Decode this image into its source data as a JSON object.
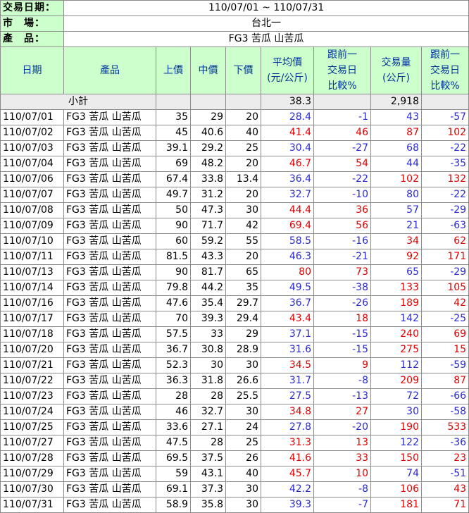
{
  "info": {
    "date_label": "交易日期：",
    "date_value": "110/07/01 ~ 110/07/31",
    "market_label": "市　場：",
    "market_value": "台北一",
    "product_label": "產　品：",
    "product_value": "FG3 苦瓜 山苦瓜"
  },
  "header": {
    "date": "日期",
    "product": "產品",
    "high": "上價",
    "mid": "中價",
    "low": "下價",
    "avg": [
      "平均價",
      "(元/公斤)"
    ],
    "avg_cmp": [
      "跟前一",
      "交易日",
      "比較%"
    ],
    "vol": [
      "交易量",
      "(公斤)"
    ],
    "vol_cmp": [
      "跟前一",
      "交易日",
      "比較%"
    ]
  },
  "subtotal": {
    "label": "小計",
    "avg": "38.3",
    "vol": "2,918"
  },
  "colors": {
    "up": "#e00000",
    "down": "#2929d6",
    "header_bg": "#ccffcc",
    "header_text": "#003399"
  },
  "rows": [
    {
      "date": "110/07/01",
      "product": "FG3 苦瓜 山苦瓜",
      "high": "35",
      "mid": "29",
      "low": "20",
      "avg": "28.4",
      "avg_cmp": "-1",
      "vol": "43",
      "vol_cmp": "-57"
    },
    {
      "date": "110/07/02",
      "product": "FG3 苦瓜 山苦瓜",
      "high": "45",
      "mid": "40.6",
      "low": "40",
      "avg": "41.4",
      "avg_cmp": "46",
      "vol": "87",
      "vol_cmp": "102"
    },
    {
      "date": "110/07/03",
      "product": "FG3 苦瓜 山苦瓜",
      "high": "39.1",
      "mid": "29.2",
      "low": "25",
      "avg": "30.4",
      "avg_cmp": "-27",
      "vol": "68",
      "vol_cmp": "-22"
    },
    {
      "date": "110/07/04",
      "product": "FG3 苦瓜 山苦瓜",
      "high": "69",
      "mid": "48.2",
      "low": "20",
      "avg": "46.7",
      "avg_cmp": "54",
      "vol": "44",
      "vol_cmp": "-35"
    },
    {
      "date": "110/07/06",
      "product": "FG3 苦瓜 山苦瓜",
      "high": "67.4",
      "mid": "33.8",
      "low": "13.4",
      "avg": "36.4",
      "avg_cmp": "-22",
      "vol": "102",
      "vol_cmp": "132"
    },
    {
      "date": "110/07/07",
      "product": "FG3 苦瓜 山苦瓜",
      "high": "49.7",
      "mid": "31.2",
      "low": "20",
      "avg": "32.7",
      "avg_cmp": "-10",
      "vol": "80",
      "vol_cmp": "-22"
    },
    {
      "date": "110/07/08",
      "product": "FG3 苦瓜 山苦瓜",
      "high": "50",
      "mid": "47.3",
      "low": "30",
      "avg": "44.4",
      "avg_cmp": "36",
      "vol": "57",
      "vol_cmp": "-29"
    },
    {
      "date": "110/07/09",
      "product": "FG3 苦瓜 山苦瓜",
      "high": "90",
      "mid": "71.7",
      "low": "42",
      "avg": "69.4",
      "avg_cmp": "56",
      "vol": "21",
      "vol_cmp": "-63"
    },
    {
      "date": "110/07/10",
      "product": "FG3 苦瓜 山苦瓜",
      "high": "60",
      "mid": "59.2",
      "low": "55",
      "avg": "58.5",
      "avg_cmp": "-16",
      "vol": "34",
      "vol_cmp": "62"
    },
    {
      "date": "110/07/11",
      "product": "FG3 苦瓜 山苦瓜",
      "high": "81.5",
      "mid": "43.3",
      "low": "20",
      "avg": "46.3",
      "avg_cmp": "-21",
      "vol": "92",
      "vol_cmp": "171"
    },
    {
      "date": "110/07/13",
      "product": "FG3 苦瓜 山苦瓜",
      "high": "90",
      "mid": "81.7",
      "low": "65",
      "avg": "80",
      "avg_cmp": "73",
      "vol": "65",
      "vol_cmp": "-29"
    },
    {
      "date": "110/07/14",
      "product": "FG3 苦瓜 山苦瓜",
      "high": "79.8",
      "mid": "44.2",
      "low": "35",
      "avg": "49.5",
      "avg_cmp": "-38",
      "vol": "133",
      "vol_cmp": "105"
    },
    {
      "date": "110/07/16",
      "product": "FG3 苦瓜 山苦瓜",
      "high": "47.6",
      "mid": "35.4",
      "low": "29.7",
      "avg": "36.7",
      "avg_cmp": "-26",
      "vol": "189",
      "vol_cmp": "42"
    },
    {
      "date": "110/07/17",
      "product": "FG3 苦瓜 山苦瓜",
      "high": "70",
      "mid": "39.3",
      "low": "29.4",
      "avg": "43.4",
      "avg_cmp": "18",
      "vol": "142",
      "vol_cmp": "-25"
    },
    {
      "date": "110/07/18",
      "product": "FG3 苦瓜 山苦瓜",
      "high": "57.5",
      "mid": "33",
      "low": "29",
      "avg": "37.1",
      "avg_cmp": "-15",
      "vol": "240",
      "vol_cmp": "69"
    },
    {
      "date": "110/07/20",
      "product": "FG3 苦瓜 山苦瓜",
      "high": "36.7",
      "mid": "30.8",
      "low": "28.9",
      "avg": "31.6",
      "avg_cmp": "-15",
      "vol": "275",
      "vol_cmp": "15"
    },
    {
      "date": "110/07/21",
      "product": "FG3 苦瓜 山苦瓜",
      "high": "52.3",
      "mid": "30",
      "low": "30",
      "avg": "34.5",
      "avg_cmp": "9",
      "vol": "112",
      "vol_cmp": "-59"
    },
    {
      "date": "110/07/22",
      "product": "FG3 苦瓜 山苦瓜",
      "high": "36.3",
      "mid": "31.8",
      "low": "26.6",
      "avg": "31.7",
      "avg_cmp": "-8",
      "vol": "209",
      "vol_cmp": "87"
    },
    {
      "date": "110/07/23",
      "product": "FG3 苦瓜 山苦瓜",
      "high": "28",
      "mid": "28",
      "low": "25.5",
      "avg": "27.5",
      "avg_cmp": "-13",
      "vol": "72",
      "vol_cmp": "-66"
    },
    {
      "date": "110/07/24",
      "product": "FG3 苦瓜 山苦瓜",
      "high": "46",
      "mid": "32.7",
      "low": "30",
      "avg": "34.8",
      "avg_cmp": "27",
      "vol": "30",
      "vol_cmp": "-58"
    },
    {
      "date": "110/07/25",
      "product": "FG3 苦瓜 山苦瓜",
      "high": "33.6",
      "mid": "27.1",
      "low": "24",
      "avg": "27.8",
      "avg_cmp": "-20",
      "vol": "190",
      "vol_cmp": "533"
    },
    {
      "date": "110/07/27",
      "product": "FG3 苦瓜 山苦瓜",
      "high": "47.5",
      "mid": "28",
      "low": "25",
      "avg": "31.3",
      "avg_cmp": "13",
      "vol": "122",
      "vol_cmp": "-36"
    },
    {
      "date": "110/07/28",
      "product": "FG3 苦瓜 山苦瓜",
      "high": "69.5",
      "mid": "37.5",
      "low": "26",
      "avg": "41.6",
      "avg_cmp": "33",
      "vol": "150",
      "vol_cmp": "23"
    },
    {
      "date": "110/07/29",
      "product": "FG3 苦瓜 山苦瓜",
      "high": "59",
      "mid": "43.1",
      "low": "40",
      "avg": "45.7",
      "avg_cmp": "10",
      "vol": "74",
      "vol_cmp": "-51"
    },
    {
      "date": "110/07/30",
      "product": "FG3 苦瓜 山苦瓜",
      "high": "69.1",
      "mid": "37.3",
      "low": "30",
      "avg": "42.2",
      "avg_cmp": "-8",
      "vol": "106",
      "vol_cmp": "43"
    },
    {
      "date": "110/07/31",
      "product": "FG3 苦瓜 山苦瓜",
      "high": "58.9",
      "mid": "35.8",
      "low": "30",
      "avg": "39.3",
      "avg_cmp": "-7",
      "vol": "181",
      "vol_cmp": "71"
    }
  ]
}
